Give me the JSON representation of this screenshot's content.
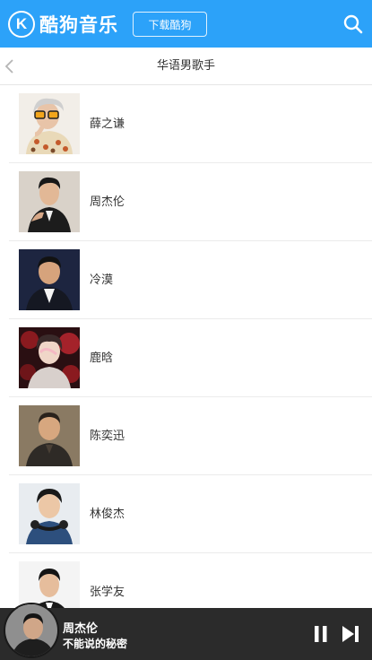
{
  "header": {
    "logo_text": "酷狗音乐",
    "logo_letter": "K",
    "download_label": "下载酷狗",
    "background_color": "#2ca2f9"
  },
  "subheader": {
    "title": "华语男歌手",
    "back_icon": "chevron-left-icon"
  },
  "singers": [
    {
      "name": "薛之谦"
    },
    {
      "name": "周杰伦"
    },
    {
      "name": "冷漠"
    },
    {
      "name": "鹿晗"
    },
    {
      "name": "陈奕迅"
    },
    {
      "name": "林俊杰"
    },
    {
      "name": "张学友"
    }
  ],
  "player": {
    "artist": "周杰伦",
    "song": "不能说的秘密",
    "pause_icon": "pause-icon",
    "next_icon": "skip-next-icon"
  }
}
